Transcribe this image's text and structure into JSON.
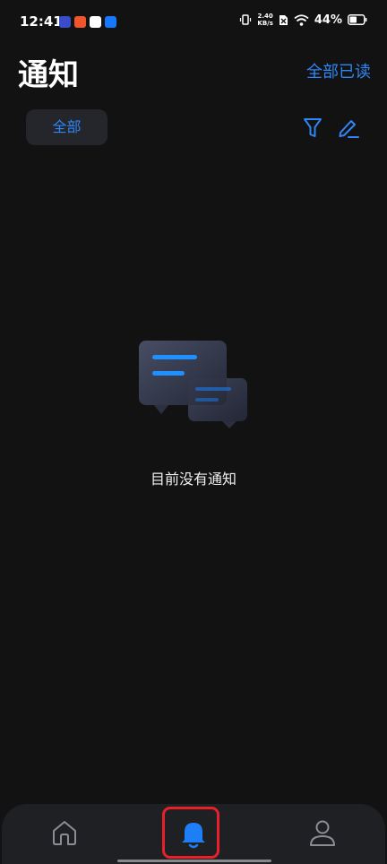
{
  "status_bar": {
    "time": "12:41",
    "net_speed_value": "2.40",
    "net_speed_unit": "KB/s",
    "battery": "44%",
    "app_icons": [
      {
        "name": "play-app-icon",
        "color": "#3b4cca"
      },
      {
        "name": "orange-app-icon",
        "color": "#f0562a"
      },
      {
        "name": "weibo-app-icon",
        "color": "#ffffff"
      },
      {
        "name": "alipay-app-icon",
        "color": "#1677ff"
      }
    ]
  },
  "header": {
    "title": "通知",
    "mark_all_read": "全部已读"
  },
  "filter": {
    "chip_label": "全部"
  },
  "empty_state": {
    "message": "目前没有通知"
  },
  "nav": {
    "items": [
      {
        "icon": "home-icon",
        "active": false
      },
      {
        "icon": "bell-icon",
        "active": true
      },
      {
        "icon": "user-icon",
        "active": false
      }
    ]
  },
  "colors": {
    "accent": "#2f86f6",
    "background": "#121212",
    "highlight": "#e8202a"
  }
}
